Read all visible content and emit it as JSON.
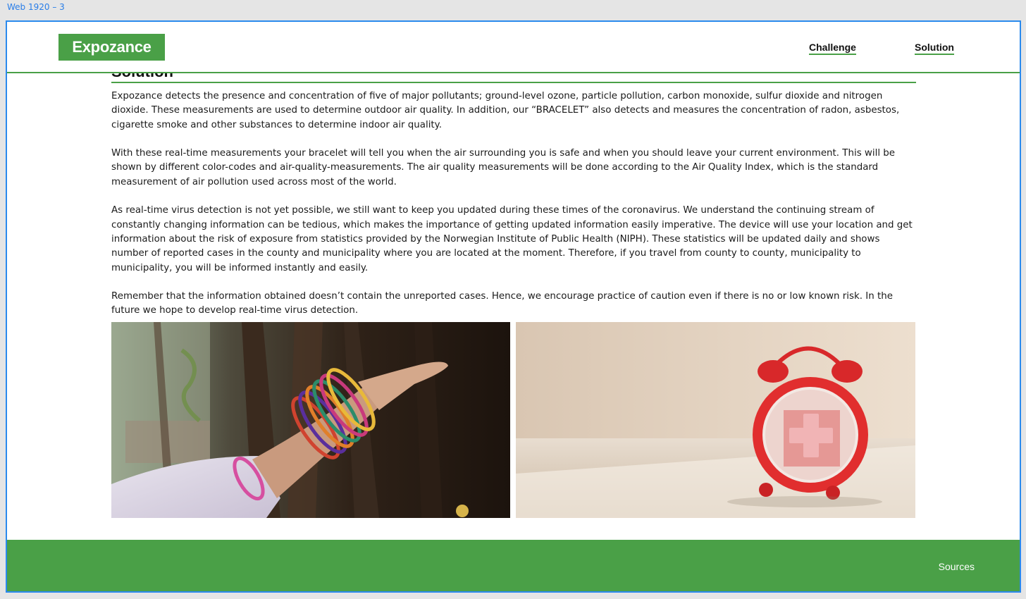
{
  "artboard": {
    "label": "Web 1920 – 3"
  },
  "header": {
    "logo_text": "Expozance",
    "nav": [
      {
        "label": "Challenge"
      },
      {
        "label": "Solution"
      }
    ]
  },
  "main": {
    "section_title": "Solution",
    "paragraphs": [
      "Expozance detects the presence and concentration of five of major pollutants; ground-level ozone, particle pollution, carbon monoxide, sulfur dioxide and nitrogen dioxide. These measurements are used to determine outdoor air quality. In addition, our “BRACELET” also detects and measures the concentration of radon, asbestos, cigarette smoke and other substances to determine indoor air quality.",
      "With these real-time measurements your bracelet will tell you when the air surrounding you is safe and when you should leave your current environment. This will be shown by different color-codes and air-quality-measurements. The air quality measurements will be done according to the Air Quality Index, which is the standard measurement of air pollution used across most of the world.",
      "As real-time virus detection is not yet possible, we still want to keep you updated during these times of the coronavirus. We understand the continuing stream of constantly changing information can be tedious, which makes the importance of getting updated information easily imperative. The device will use your location and get information about the risk of exposure from statistics provided by the Norwegian Institute of Public Health (NIPH). These statistics will be updated daily and shows number of reported cases in the county and municipality where you are located at the moment. Therefore, if you travel from county to county, municipality to municipality, you will be informed instantly and easily.",
      "Remember that the information obtained doesn’t contain the unreported cases. Hence, we encourage practice of caution even if there is no or low known risk. In the future we hope to develop real-time virus detection."
    ],
    "images": [
      {
        "name": "hand-with-bangles-photo"
      },
      {
        "name": "red-alarm-clock-photo"
      }
    ]
  },
  "footer": {
    "link_label": "Sources"
  },
  "colors": {
    "brand_green": "#4aa047",
    "frame_blue": "#2b8aed",
    "artboard_label_blue": "#2a7ee8"
  }
}
